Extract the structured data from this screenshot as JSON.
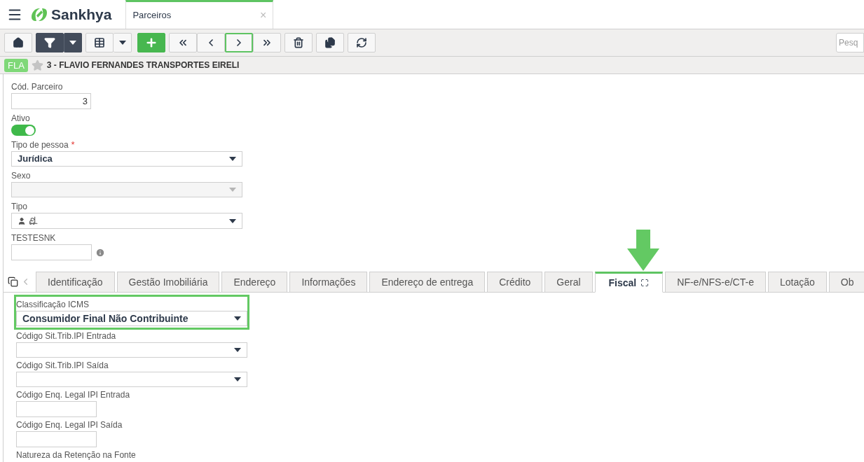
{
  "header": {
    "app_name": "Sankhya",
    "tab": {
      "label": "Parceiros",
      "close": "×",
      "selected": true
    }
  },
  "toolbar": {
    "buttons": [
      {
        "kind": "home",
        "selected": false
      },
      {
        "kind": "filter",
        "selected": false
      },
      {
        "kind": "grid",
        "selected": false
      },
      {
        "kind": "add",
        "selected": false
      },
      {
        "kind": "first",
        "selected": false
      },
      {
        "kind": "prev",
        "selected": false
      },
      {
        "kind": "next",
        "selected": true
      },
      {
        "kind": "last",
        "selected": false
      },
      {
        "kind": "delete",
        "selected": false
      },
      {
        "kind": "duplicate",
        "selected": false
      },
      {
        "kind": "refresh",
        "selected": false
      }
    ],
    "search": {
      "placeholder": "Pesq"
    }
  },
  "record": {
    "badge": "FLA",
    "favorite": false,
    "title": "3 - FLAVIO FERNANDES TRANSPORTES EIRELI"
  },
  "fields": [
    {
      "kind": "text",
      "label": "Cód. Parceiro",
      "value": "3"
    },
    {
      "kind": "toggle",
      "label": "Ativo",
      "on": true
    },
    {
      "kind": "select",
      "label": "Tipo de pessoa",
      "required_mark": "*",
      "disabled": false,
      "value": "Jurídica"
    },
    {
      "kind": "select",
      "label": "Sexo",
      "disabled": true
    },
    {
      "kind": "icons",
      "label": "Tipo"
    },
    {
      "kind": "info",
      "label": "TESTESNK"
    }
  ],
  "tabs": [
    {
      "label": "Identificação",
      "selected": false
    },
    {
      "label": "Gestão Imobiliária",
      "selected": false
    },
    {
      "label": "Endereço",
      "selected": false
    },
    {
      "label": "Informações",
      "selected": false
    },
    {
      "label": "Endereço de entrega",
      "selected": false
    },
    {
      "label": "Crédito",
      "selected": false
    },
    {
      "label": "Geral",
      "selected": false
    },
    {
      "label": "Fiscal",
      "selected": true
    },
    {
      "label": "NF-e/NFS-e/CT-e",
      "selected": false
    },
    {
      "label": "Lotação",
      "selected": false
    },
    {
      "label": "Ob",
      "selected": false
    }
  ],
  "fiscal_fields": [
    {
      "kind": "select",
      "label": "Classificação ICMS",
      "value": "Consumidor Final Não Contribuinte",
      "highlighted": true
    },
    {
      "kind": "select",
      "label": "Código Sit.Trib.IPI Entrada",
      "highlighted": false
    },
    {
      "kind": "select",
      "label": "Código Sit.Trib.IPI Saída",
      "highlighted": false
    },
    {
      "kind": "text",
      "label": "Código Enq. Legal IPI Entrada",
      "highlighted": false
    },
    {
      "kind": "text",
      "label": "Código Enq. Legal IPI Saída",
      "highlighted": false
    },
    {
      "kind": "label",
      "label": "Natureza da Retenção na Fonte",
      "highlighted": false
    }
  ]
}
